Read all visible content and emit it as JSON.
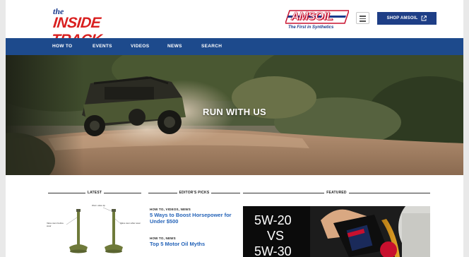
{
  "header": {
    "logo": {
      "the": "the",
      "main": "INSIDE TRACK"
    },
    "amsoil": {
      "brand": "AMSOIL",
      "tagline": "The First in Synthetics"
    },
    "shop_label": "SHOP AMSOIL"
  },
  "nav": {
    "items": [
      {
        "label": "HOW TO"
      },
      {
        "label": "EVENTS"
      },
      {
        "label": "VIDEOS"
      },
      {
        "label": "NEWS"
      },
      {
        "label": "SEARCH"
      }
    ]
  },
  "hero": {
    "title": "RUN WITH US"
  },
  "sections": {
    "latest": "LATEST",
    "editors_picks": "EDITOR'S PICKS",
    "featured": "FEATURED"
  },
  "latest_image": {
    "captions": {
      "left": "Valve stem before wear",
      "top": "Worn valve tip",
      "right": "Valve stem after wear"
    }
  },
  "editors_picks": [
    {
      "category": "HOW TO, VIDEOS, NEWS",
      "title": "5 Ways to Boost Horsepower for Under $500"
    },
    {
      "category": "HOW TO, NEWS",
      "title": "Top 5 Motor Oil Myths"
    }
  ],
  "featured": {
    "line1": "5W-20",
    "line2": "VS",
    "line3": "5W-30"
  },
  "colors": {
    "nav_blue": "#1d4a8c",
    "shop_button": "#1e3e86",
    "logo_red": "#d92020",
    "link_blue": "#2463b8"
  }
}
